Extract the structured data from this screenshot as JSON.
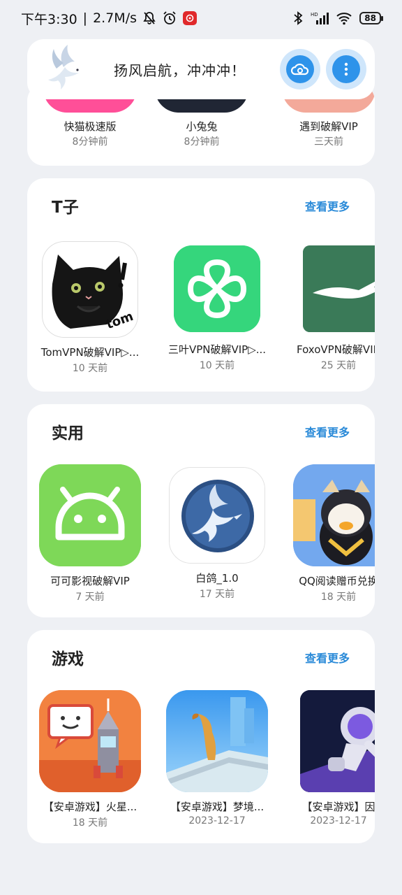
{
  "status_bar": {
    "time": "下午3:30",
    "separator": "|",
    "speed": "2.7M/s",
    "battery": "88",
    "icons": [
      "bell-off-icon",
      "alarm-icon",
      "netease-music-icon",
      "bluetooth-icon",
      "signal-icon",
      "wifi-icon",
      "battery-icon"
    ]
  },
  "header": {
    "slogan": "扬风启航，冲冲冲！",
    "logo": "dove-logo",
    "buttons": [
      "cloud-sync-icon",
      "more-vertical-icon"
    ],
    "accent": "#2e93ea"
  },
  "top_section": {
    "items": [
      {
        "name": "快猫极速版",
        "time": "8分钟前",
        "color": "#ff4f98"
      },
      {
        "name": "小兔兔",
        "time": "8分钟前",
        "color": "#202634"
      },
      {
        "name": "遇到破解VIP",
        "time": "三天前",
        "color": "#f3a99a"
      }
    ]
  },
  "sections": [
    {
      "title": "T子",
      "more": "查看更多",
      "apps": [
        {
          "name": "TomVPN破解VIP▷...",
          "time": "10 天前",
          "icon": "black-cat-icon"
        },
        {
          "name": "三叶VPN破解VIP▷...",
          "time": "10 天前",
          "icon": "clover-icon"
        },
        {
          "name": "FoxoVPN破解VIP",
          "time": "25 天前",
          "icon": "fox-icon"
        }
      ]
    },
    {
      "title": "实用",
      "more": "查看更多",
      "apps": [
        {
          "name": "可可影视破解VIP",
          "time": "7 天前",
          "icon": "android-icon"
        },
        {
          "name": "白鸽_1.0",
          "time": "17 天前",
          "icon": "dove-icon"
        },
        {
          "name": "QQ阅读赠币兑换",
          "time": "18 天前",
          "icon": "penguin-icon"
        }
      ]
    },
    {
      "title": "游戏",
      "more": "查看更多",
      "apps": [
        {
          "name": "【安卓游戏】火星...",
          "time": "18 天前",
          "icon": "pixel-rocket-icon"
        },
        {
          "name": "【安卓游戏】梦境...",
          "time": "2023-12-17",
          "icon": "dream-path-icon"
        },
        {
          "name": "【安卓游戏】因",
          "time": "2023-12-17",
          "icon": "astronaut-icon"
        }
      ]
    }
  ]
}
